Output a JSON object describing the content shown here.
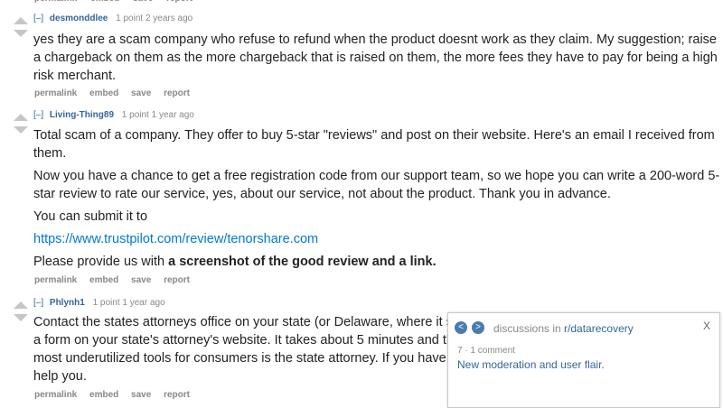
{
  "top_buttons": [
    "permalink",
    "embed",
    "save",
    "report"
  ],
  "comments": [
    {
      "toggle": "[–]",
      "author": "desmonddlee",
      "meta": "1 point 2 years ago",
      "paragraphs": [
        "yes they are a scam company who refuse to refund when the product doesnt work as they claim. My suggestion; raise a chargeback on them as the more chargeback that is raised on them, the more fees they have to pay for being a high risk merchant."
      ],
      "buttons": [
        "permalink",
        "embed",
        "save",
        "report"
      ]
    },
    {
      "toggle": "[–]",
      "author": "Living-Thing89",
      "meta": "1 point 1 year ago",
      "paragraphs": [
        "Total scam of a company. They offer to buy 5-star \"reviews\" and post on their website. Here's an email I received from them.",
        "Now you have a chance to get a free registration code from our support team, so we hope you can write a 200-word 5-star review to rate our service, yes, about our service, not about the product. Thank you in advance.",
        "You can submit it to"
      ],
      "link": "https://www.trustpilot.com/review/tenorshare.com",
      "last_prefix": "Please provide us with ",
      "last_bold": "a screenshot of the good review and a link.",
      "buttons": [
        "permalink",
        "embed",
        "save",
        "report"
      ]
    },
    {
      "toggle": "[–]",
      "author": "Phlynh1",
      "meta": "1 point 1 year ago",
      "paragraphs": [
        "Contact the states attorneys office on your state (or Delaware, where it seems to be incorporated). They usually fill out a form on your state's attorney's website. It takes about 5 minutes and they usually get your money back. One of the most underutilized tools for consumers is the state attorney. If you have a complaint and can't get anywhere they will help you."
      ],
      "buttons": [
        "permalink",
        "embed",
        "save",
        "report"
      ]
    }
  ],
  "popup": {
    "prev": "<",
    "next": ">",
    "title_prefix": "discussions in ",
    "subreddit": "r/datarecovery",
    "close": "X",
    "meta": "7 · 1 comment",
    "link": "New moderation and user flair."
  },
  "colors": {
    "link": "#0079d3",
    "author": "#369",
    "muted": "#888",
    "arrow": "#c6c6c6",
    "nav": "#4a7bb0"
  }
}
